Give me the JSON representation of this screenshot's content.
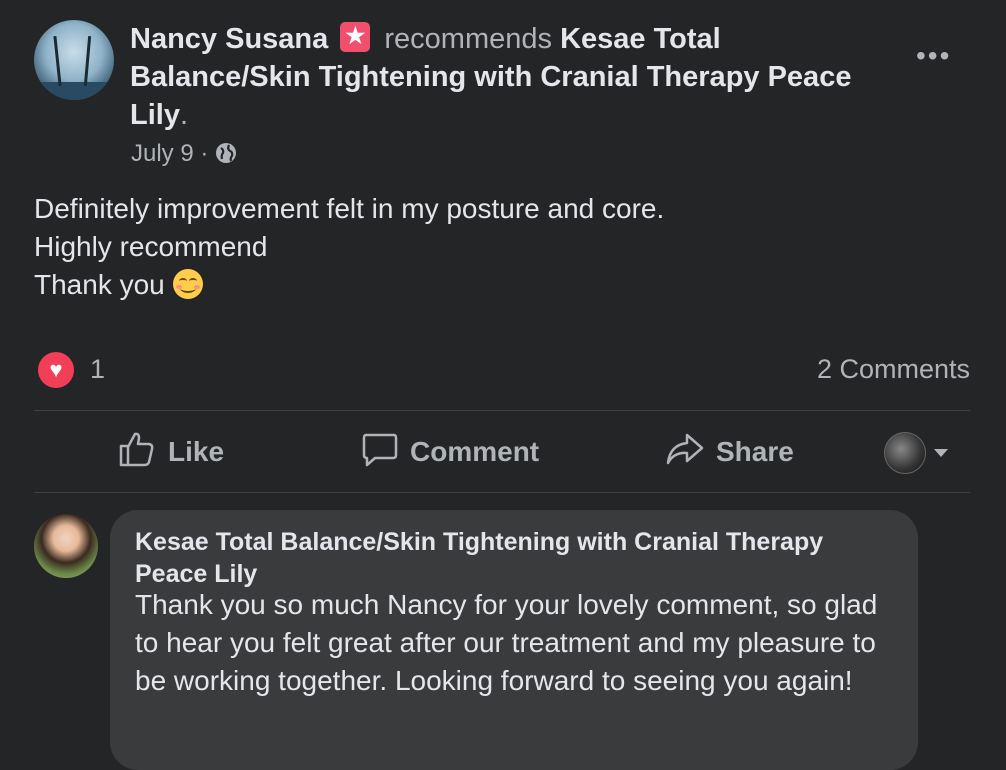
{
  "post": {
    "author": "Nancy Susana",
    "verb": "recommends",
    "page": "Kesae Total Balance/Skin Tightening with Cranial Therapy Peace Lily",
    "period": ".",
    "date": "July 9",
    "dot": " · ",
    "body_line1": "Definitely improvement felt in my posture and core.",
    "body_line2": "Highly recommend",
    "body_line3": "Thank you",
    "more_label": "•••"
  },
  "stats": {
    "reaction_count": "1",
    "comments": "2 Comments"
  },
  "actions": {
    "like": "Like",
    "comment": "Comment",
    "share": "Share"
  },
  "comment": {
    "author": "Kesae Total Balance/Skin Tightening with Cranial Therapy Peace Lily",
    "text": "Thank you so much Nancy for your lovely comment, so glad to hear you felt great after our treatment and my pleasure to be working together. Looking forward to seeing you again!"
  },
  "colors": {
    "background": "#242526",
    "bubble": "#3a3b3c",
    "heart": "#f33e58",
    "badge": "#f0506e"
  },
  "icons": [
    "star-badge-icon",
    "globe-icon",
    "more-icon",
    "heart-reaction-icon",
    "like-icon",
    "comment-icon",
    "share-icon",
    "caret-down-icon",
    "smiling-emoji-icon"
  ]
}
